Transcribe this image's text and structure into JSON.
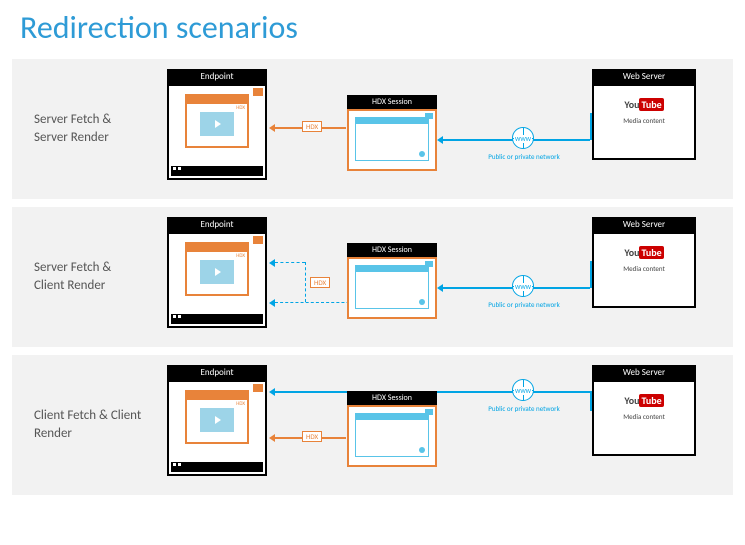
{
  "title": "Redirection scenarios",
  "labels": {
    "endpoint": "Endpoint",
    "hdx_session": "HDX Session",
    "web_server": "Web Server",
    "hdx_badge": "HDX",
    "www": "WWW",
    "network": "Public or private network",
    "media": "Media content",
    "youtube_you": "You",
    "youtube_tube": "Tube"
  },
  "scenarios": [
    {
      "name": "Server Fetch & Server Render"
    },
    {
      "name": "Server Fetch & Client Render"
    },
    {
      "name": "Client Fetch & Client Render"
    }
  ]
}
